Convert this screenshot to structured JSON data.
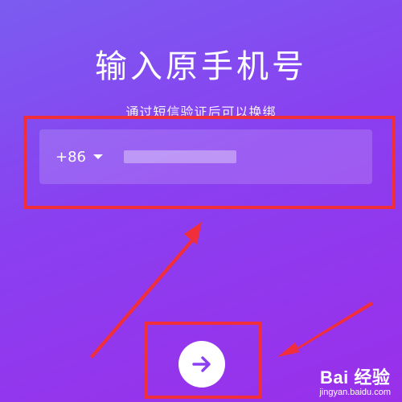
{
  "header": {
    "title": "输入原手机号",
    "subtitle": "通过短信验证后可以换绑"
  },
  "phone": {
    "country_code": "+86",
    "number_masked": true
  },
  "actions": {
    "next_icon": "arrow-right-icon"
  },
  "annotations": {
    "color": "#f02f3a"
  },
  "watermark": {
    "brand": "Bai  经验",
    "url": "jingyan.baidu.com"
  },
  "colors": {
    "background_start": "#7b5cf0",
    "background_end": "#9a2fea",
    "accent": "#8b3ff0"
  }
}
